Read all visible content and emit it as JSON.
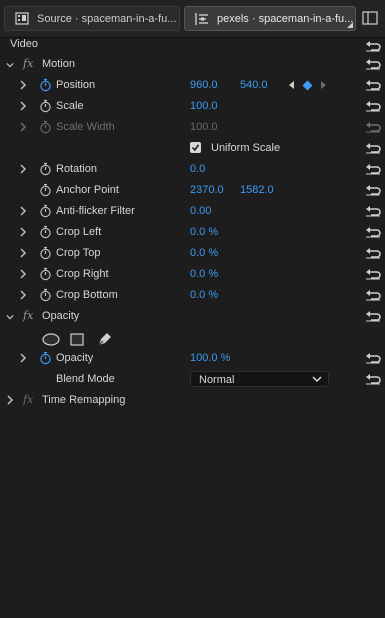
{
  "tabs": [
    {
      "label": "Source · spaceman-in-a-fu...",
      "icon": "source-monitor-icon",
      "active": false
    },
    {
      "label": "pexels · spaceman-in-a-fu...",
      "icon": "effect-controls-icon",
      "active": true
    }
  ],
  "panel": {
    "section_label": "Video",
    "panel_icon": "panel-toggle-icon"
  },
  "motion": {
    "name": "Motion",
    "properties": {
      "position": {
        "label": "Position",
        "x": "960.0",
        "y": "540.0"
      },
      "scale": {
        "label": "Scale",
        "value": "100.0"
      },
      "scale_width": {
        "label": "Scale Width",
        "value": "100.0",
        "disabled": true
      },
      "uniform_scale": {
        "label": "Uniform Scale",
        "checked": true
      },
      "rotation": {
        "label": "Rotation",
        "value": "0.0"
      },
      "anchor_point": {
        "label": "Anchor Point",
        "x": "2370.0",
        "y": "1582.0"
      },
      "anti_flicker": {
        "label": "Anti-flicker Filter",
        "value": "0.00"
      },
      "crop_left": {
        "label": "Crop Left",
        "value": "0.0 %"
      },
      "crop_top": {
        "label": "Crop Top",
        "value": "0.0 %"
      },
      "crop_right": {
        "label": "Crop Right",
        "value": "0.0 %"
      },
      "crop_bottom": {
        "label": "Crop Bottom",
        "value": "0.0 %"
      }
    }
  },
  "opacity": {
    "name": "Opacity",
    "mask_tools": [
      "ellipse-mask-icon",
      "rectangle-mask-icon",
      "pen-mask-icon"
    ],
    "opacity_label": "Opacity",
    "opacity_value": "100.0 %",
    "blend_mode_label": "Blend Mode",
    "blend_mode_value": "Normal"
  },
  "time_remapping": {
    "name": "Time Remapping"
  },
  "colors": {
    "value_blue": "#3c9bf5",
    "background": "#1d1d1d",
    "disabled": "#6e6e6e"
  }
}
